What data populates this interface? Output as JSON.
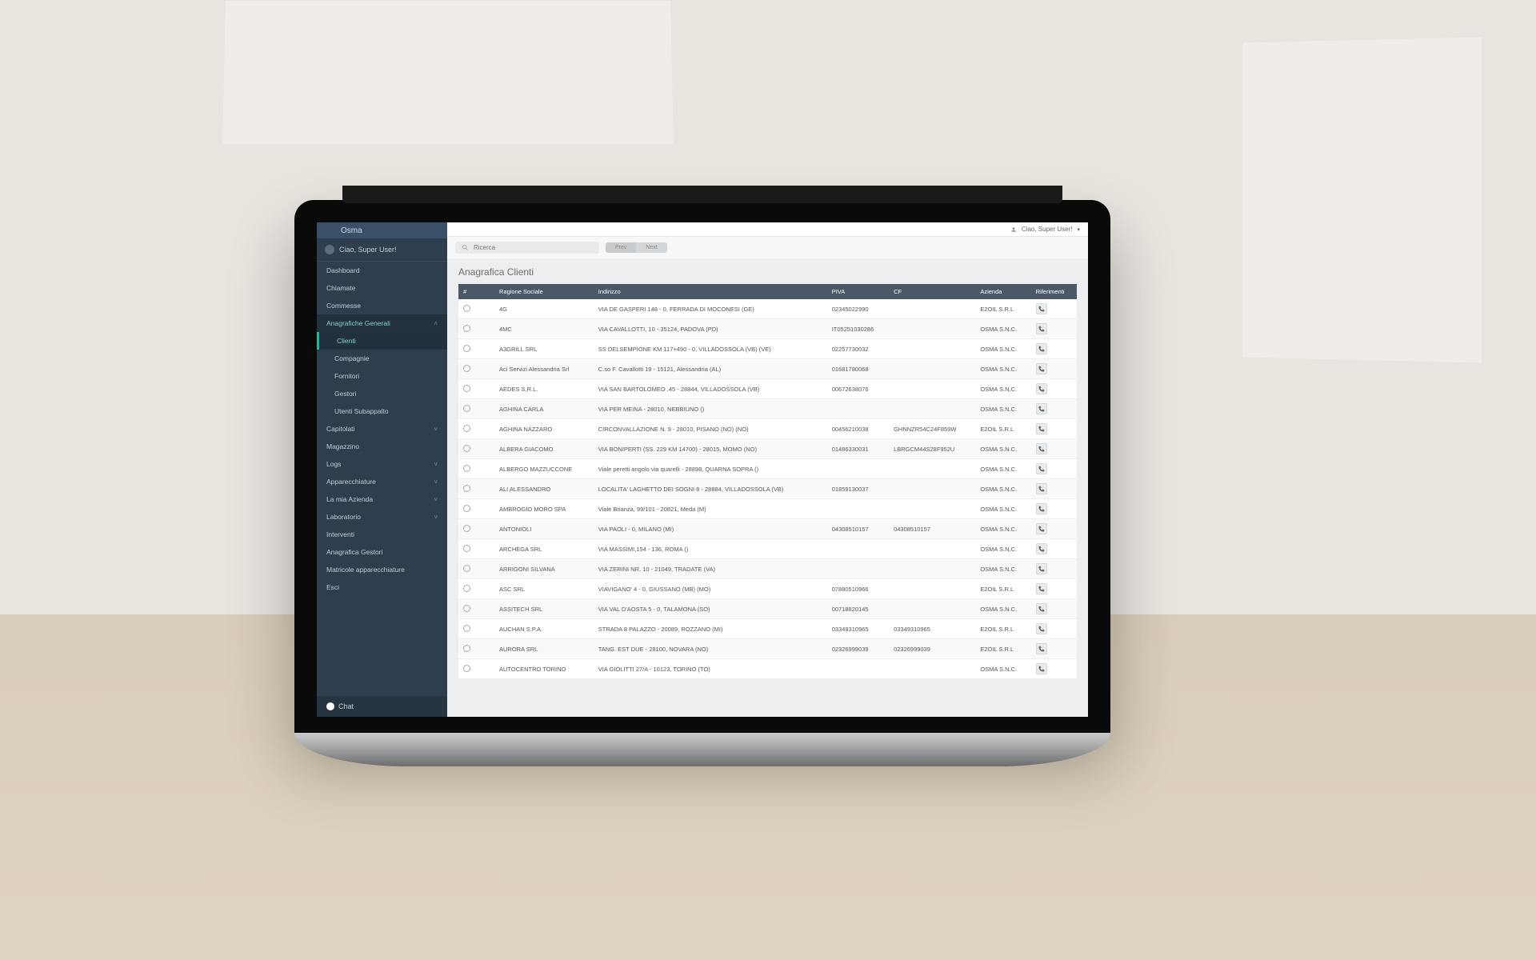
{
  "brand": "Osma",
  "user_greeting": "Ciao, Super User!",
  "topbar": {
    "user_label": "Ciao, Super User!"
  },
  "search": {
    "placeholder": "Ricerca"
  },
  "pills": {
    "a": "Prev",
    "b": "Next"
  },
  "sidebar": {
    "items": [
      {
        "label": "Dashboard"
      },
      {
        "label": "Chiamate"
      },
      {
        "label": "Commesse"
      },
      {
        "label": "Anagrafiche Generali",
        "expandable": true,
        "active": true
      },
      {
        "label": "Clienti",
        "sub": true,
        "subactive": true
      },
      {
        "label": "Compagnie",
        "sub": true
      },
      {
        "label": "Fornitori",
        "sub": true
      },
      {
        "label": "Gestori",
        "sub": true
      },
      {
        "label": "Utenti Subappalto",
        "sub": true
      },
      {
        "label": "Capitolati",
        "expandable": true
      },
      {
        "label": "Magazzino"
      },
      {
        "label": "Logs",
        "expandable": true
      },
      {
        "label": "Apparecchiature",
        "expandable": true
      },
      {
        "label": "La mia Azienda",
        "expandable": true
      },
      {
        "label": "Laboratorio",
        "expandable": true
      },
      {
        "label": "Interventi"
      },
      {
        "label": "Anagrafica Gestori"
      },
      {
        "label": "Matricole apparecchiature"
      },
      {
        "label": "Esci"
      }
    ]
  },
  "chat_label": "Chat",
  "page": {
    "title": "Anagrafica Clienti"
  },
  "table": {
    "headers": [
      "#",
      "",
      "Ragione Sociale",
      "Indirizzo",
      "PIVA",
      "CF",
      "Azienda",
      "Riferimenti"
    ],
    "rows": [
      {
        "ragione": "4G",
        "indirizzo": "VIA DE GASPERI 148 - 0, FERRADA DI MOCONESI (GE)",
        "piva": "02345022990",
        "cf": "",
        "azienda": "E2OIL S.R.L"
      },
      {
        "ragione": "4MC",
        "indirizzo": "VIA CAVALLOTTI, 10 - 35124, PADOVA (PD)",
        "piva": "IT05251030286",
        "cf": "",
        "azienda": "OSMA S.N.C."
      },
      {
        "ragione": "A3GRILL SRL",
        "indirizzo": "SS DELSEMPIONE KM 117+490 - 0, VILLADOSSOLA (VB) (VE)",
        "piva": "02257730032",
        "cf": "",
        "azienda": "OSMA S.N.C."
      },
      {
        "ragione": "Aci Servizi Alessandria Srl",
        "indirizzo": "C.so F. Cavallotti 19 - 15121, Alessandria (AL)",
        "piva": "01681780068",
        "cf": "",
        "azienda": "OSMA S.N.C."
      },
      {
        "ragione": "AEDES S.R.L.",
        "indirizzo": "VIA SAN BARTOLOMEO ,45 - 28844, VILLADOSSOLA (VB)",
        "piva": "00672638076",
        "cf": "",
        "azienda": "OSMA S.N.C."
      },
      {
        "ragione": "AGHINA CARLA",
        "indirizzo": "VIA PER MEINA - 28010, NEBBIUNO ()",
        "piva": "",
        "cf": "",
        "azienda": "OSMA S.N.C."
      },
      {
        "ragione": "AGHINA NAZZARO",
        "indirizzo": "CIRCONVALLAZIONE N. 9 - 28010, PISANO (NO) (NO)",
        "piva": "00456210038",
        "cf": "GHNNZR54C24F859W",
        "azienda": "E2OIL S.R.L"
      },
      {
        "ragione": "ALBERA GIACOMO",
        "indirizzo": "VIA BONIPERTI (SS. 229 KM 14700) - 28015, MOMO (NO)",
        "piva": "01486330031",
        "cf": "LBRGCM44S28F952U",
        "azienda": "OSMA S.N.C."
      },
      {
        "ragione": "ALBERGO MAZZUCCONE",
        "indirizzo": "Viale peretti angolo via quarelli - 28898, QUARNA SOPRA ()",
        "piva": "",
        "cf": "",
        "azienda": "OSMA S.N.C."
      },
      {
        "ragione": "ALI ALESSANDRO",
        "indirizzo": "LOCALITA' LAGHETTO DEI SOGNI 8 - 28884, VILLADOSSOLA (VB)",
        "piva": "01859130037",
        "cf": "",
        "azienda": "OSMA S.N.C."
      },
      {
        "ragione": "AMBROGIO MORO SPA",
        "indirizzo": "Viale Brianza, 99/101 - 20821, Meda (M)",
        "piva": "",
        "cf": "",
        "azienda": "OSMA S.N.C."
      },
      {
        "ragione": "ANTONIOLI",
        "indirizzo": "VIA PAOLI - 0, MILANO (MI)",
        "piva": "04308510157",
        "cf": "04308510157",
        "azienda": "OSMA S.N.C."
      },
      {
        "ragione": "ARCHEGA SRL",
        "indirizzo": "VIA MASSIMI,154 - 136, ROMA ()",
        "piva": "",
        "cf": "",
        "azienda": "OSMA S.N.C."
      },
      {
        "ragione": "ARRIGONI SILVANA",
        "indirizzo": "VIA ZERINI NR. 10 - 21049, TRADATE (VA)",
        "piva": "",
        "cf": "",
        "azienda": "OSMA S.N.C."
      },
      {
        "ragione": "ASC SRL",
        "indirizzo": "VIAVIGANO' 4 - 0, GIUSSANO (MB) (MO)",
        "piva": "07880510966",
        "cf": "",
        "azienda": "E2OIL S.R.L"
      },
      {
        "ragione": "ASSITECH SRL",
        "indirizzo": "VIA VAL D'AOSTA 5 - 0, TALAMONA (SO)",
        "piva": "00718820145",
        "cf": "",
        "azienda": "OSMA S.N.C."
      },
      {
        "ragione": "AUCHAN S.P.A.",
        "indirizzo": "STRADA 8 PALAZZO - 20089, ROZZANO (MI)",
        "piva": "03349310965",
        "cf": "03349310965",
        "azienda": "E2OIL S.R.L"
      },
      {
        "ragione": "AURORA SRL",
        "indirizzo": "TANG. EST DUE - 28100, NOVARA (NO)",
        "piva": "02326999039",
        "cf": "02326999039",
        "azienda": "E2OIL S.R.L"
      },
      {
        "ragione": "AUTOCENTRO TORINO",
        "indirizzo": "VIA GIOLITTI 27/A - 10123, TORINO (TO)",
        "piva": "",
        "cf": "",
        "azienda": "OSMA S.N.C."
      }
    ]
  }
}
